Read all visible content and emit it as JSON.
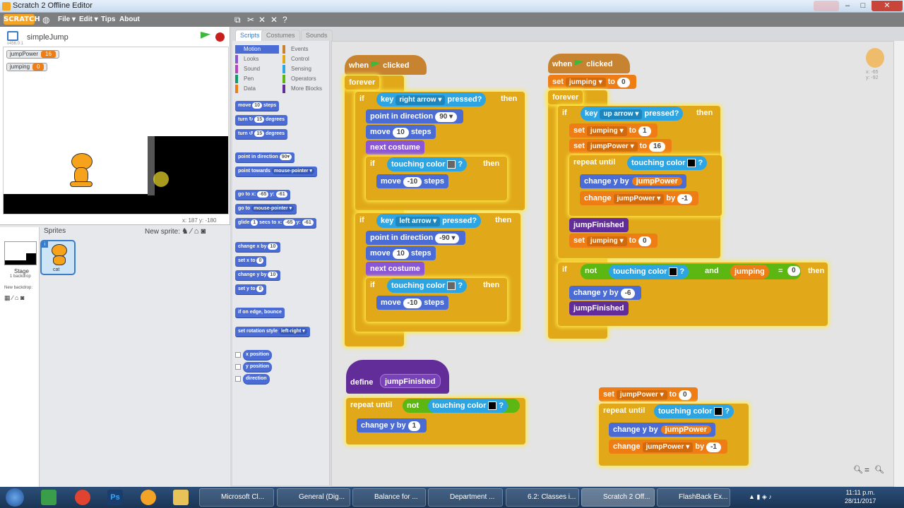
{
  "window": {
    "title": "Scratch 2 Offline Editor"
  },
  "menubar": {
    "logo": "SCRATCH",
    "items": [
      "File ▾",
      "Edit ▾",
      "Tips",
      "About"
    ]
  },
  "stage": {
    "project_name": "simpleJump",
    "version": "v456.0.1",
    "monitors": [
      {
        "name": "jumpPower",
        "value": "16"
      },
      {
        "name": "jumping",
        "value": "0"
      }
    ],
    "coords": "x: 187   y: -180"
  },
  "sprites": {
    "header": "Sprites",
    "new_sprite": "New sprite:",
    "stage_label": "Stage",
    "stage_sub": "1 backdrop",
    "new_backdrop": "New backdrop:",
    "sprite_name": "cat"
  },
  "tabs": [
    "Scripts",
    "Costumes",
    "Sounds"
  ],
  "categories": {
    "left": [
      "Motion",
      "Looks",
      "Sound",
      "Pen",
      "Data"
    ],
    "right": [
      "Events",
      "Control",
      "Sensing",
      "Operators",
      "More Blocks"
    ]
  },
  "palette": {
    "move": [
      "move",
      "10",
      "steps"
    ],
    "turn_r": [
      "turn ↻",
      "15",
      "degrees"
    ],
    "turn_l": [
      "turn ↺",
      "15",
      "degrees"
    ],
    "point_dir": [
      "point in direction",
      "90▾"
    ],
    "point_towards": [
      "point towards",
      "mouse-pointer ▾"
    ],
    "goto_xy": [
      "go to x:",
      "-65",
      "y:",
      "-61"
    ],
    "goto": [
      "go to",
      "mouse-pointer ▾"
    ],
    "glide": [
      "glide",
      "1",
      "secs to x:",
      "-65",
      "y:",
      "-61"
    ],
    "change_x": [
      "change x by",
      "10"
    ],
    "set_x": [
      "set x to",
      "0"
    ],
    "change_y": [
      "change y by",
      "10"
    ],
    "set_y": [
      "set y to",
      "0"
    ],
    "bounce": "if on edge, bounce",
    "rot_style": [
      "set rotation style",
      "left-right ▾"
    ],
    "reporters": [
      "x position",
      "y position",
      "direction"
    ]
  },
  "script1": {
    "hat": [
      "when",
      "clicked"
    ],
    "forever": "forever",
    "if": "if",
    "then": "then",
    "key": "key",
    "right_arrow": "right arrow ▾",
    "left_arrow": "left arrow ▾",
    "pressed": "pressed?",
    "point": "point in direction",
    "dir90": "90 ▾",
    "dirm90": "-90 ▾",
    "move": "move",
    "v10": "10",
    "vm10": "-10",
    "steps": "steps",
    "next_costume": "next costume",
    "touching_color": "touching color",
    "q": "?"
  },
  "script2": {
    "hat": [
      "when",
      "clicked"
    ],
    "set": "set",
    "to": "to",
    "jumping": "jumping ▾",
    "jumpPower": "jumpPower ▾",
    "v0": "0",
    "v1": "1",
    "v16": "16",
    "forever": "forever",
    "if": "if",
    "then": "then",
    "key": "key",
    "up_arrow": "up arrow ▾",
    "pressed": "pressed?",
    "repeat_until": "repeat until",
    "touching_color": "touching color",
    "q": "?",
    "change_y_by": "change  y  by",
    "jumpPower_r": "jumpPower",
    "change": "change",
    "by": "by",
    "vm1": "-1",
    "jumpFinished": "jumpFinished",
    "not": "not",
    "and": "and",
    "jumping_r": "jumping",
    "eq": "=",
    "vm6": "-6"
  },
  "script3": {
    "define": "define",
    "name": "jumpFinished",
    "repeat_until": "repeat until",
    "not": "not",
    "touching_color": "touching color",
    "q": "?",
    "change_y_by": "change  y  by",
    "v1": "1"
  },
  "script4": {
    "set": "set",
    "jumpPower": "jumpPower ▾",
    "to": "to",
    "v0": "0",
    "repeat_until": "repeat until",
    "touching_color": "touching color",
    "q": "?",
    "change_y_by": "change  y  by",
    "jumpPower_r": "jumpPower",
    "change": "change",
    "by": "by",
    "vm1": "-1"
  },
  "sprite_info": {
    "x": "x: -65",
    "y": "y: -92"
  },
  "taskbar": {
    "items": [
      "Microsoft Cl...",
      "General (Dig...",
      "Balance for ...",
      "Department ...",
      "6.2: Classes i...",
      "Scratch 2 Off...",
      "FlashBack Ex..."
    ],
    "time": "11:11 p.m.",
    "date": "28/11/2017"
  },
  "colors": {
    "motion": "#4a6cd4",
    "control": "#e1a91a",
    "events": "#c88330",
    "looks": "#8a55d7",
    "sensing": "#2ca5e2",
    "operators": "#5cb712",
    "data": "#ee7d16",
    "more_blocks": "#632d99"
  }
}
